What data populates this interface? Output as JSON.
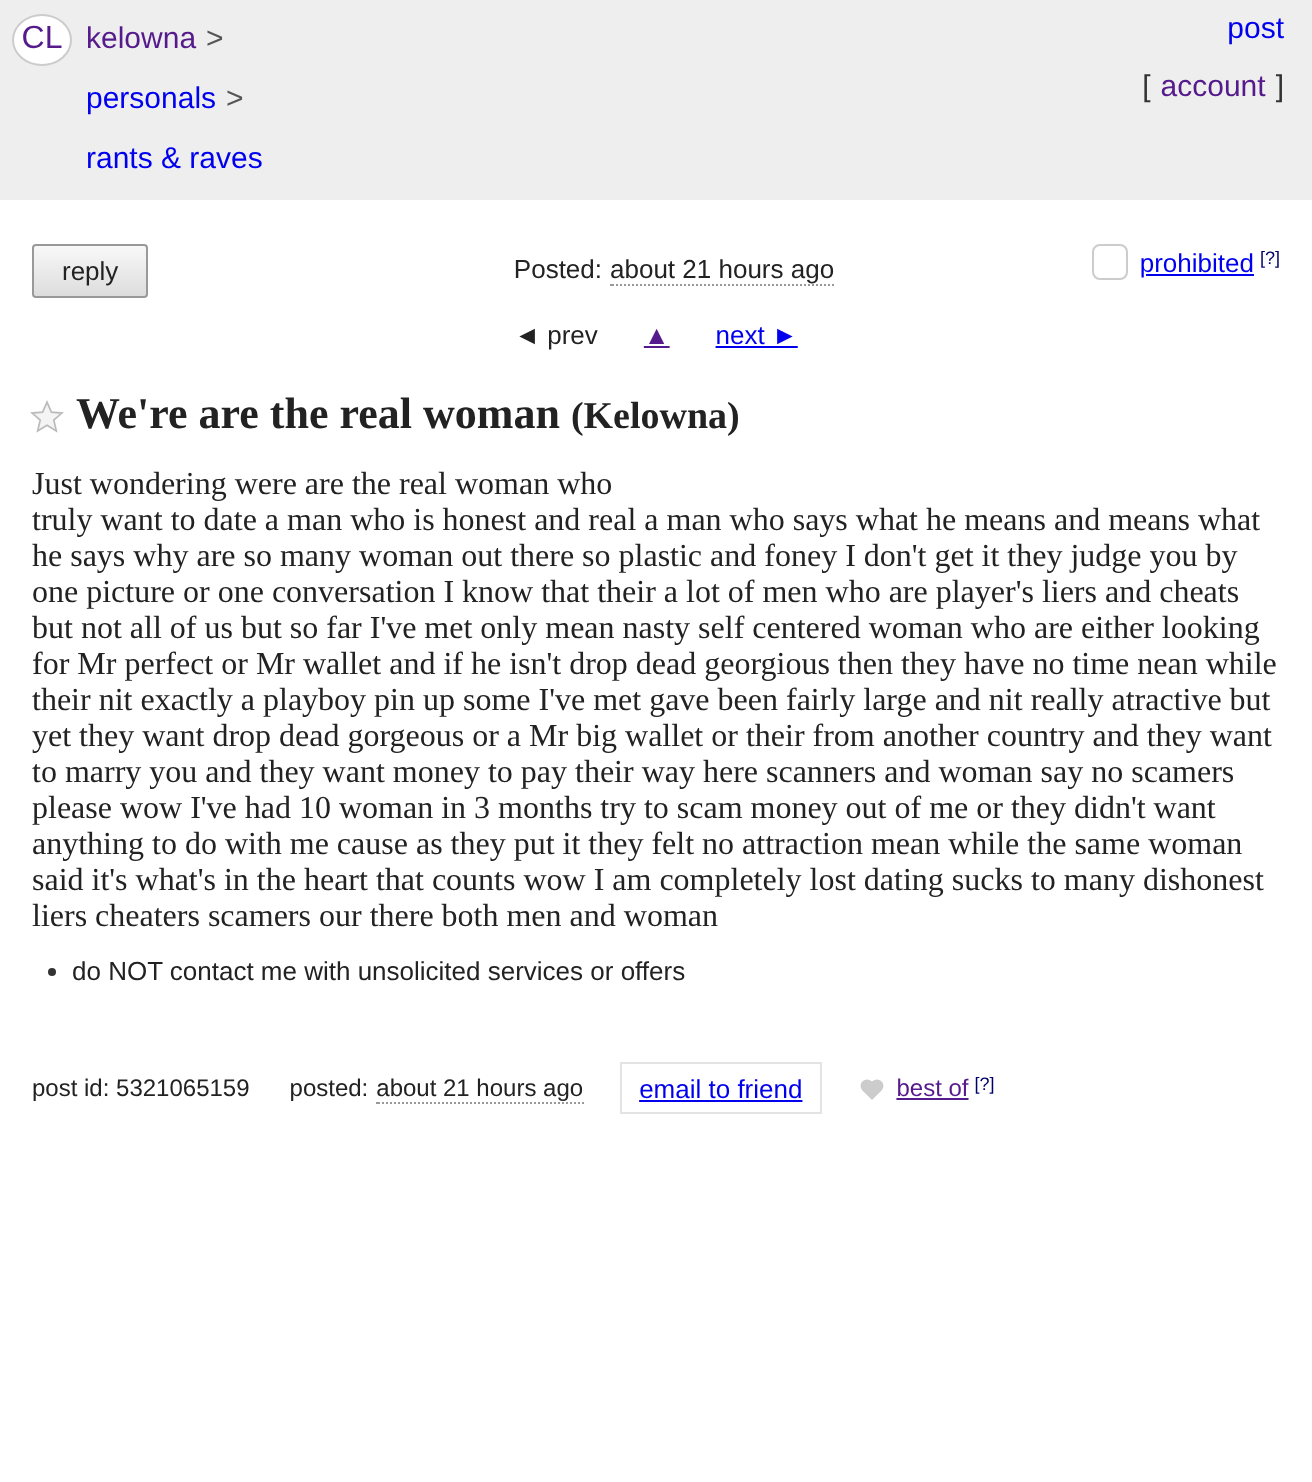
{
  "header": {
    "logo": "CL",
    "breadcrumbs": [
      {
        "label": "kelowna",
        "separator": ">",
        "visited": true
      },
      {
        "label": "personals",
        "separator": ">",
        "visited": false
      },
      {
        "label": "rants & raves",
        "visited": false
      }
    ],
    "post_link": {
      "label": "post",
      "visited": false
    },
    "account": {
      "open": "[",
      "label": "account",
      "close": "]",
      "visited": true
    }
  },
  "toolbar": {
    "reply_button": "reply",
    "posted": {
      "label": "Posted:",
      "time": "about 21 hours ago"
    },
    "flag": {
      "checked": false,
      "label": "prohibited",
      "help": "[?]"
    }
  },
  "nav": [
    {
      "kind": "text",
      "label": "◄ prev"
    },
    {
      "kind": "link",
      "label": "▲",
      "visited": true
    },
    {
      "kind": "link",
      "label": "next ►",
      "visited": false
    }
  ],
  "posting": {
    "favorited": false,
    "title": "We're are the real woman",
    "location": "(Kelowna)",
    "body": [
      "Just wondering were are the real woman who",
      "truly want to date a man who is honest and real a man who says what he means and means what he says why are so many woman out there so plastic and foney I don't get it they judge you by one picture or one conversation I know that their a lot of men who are player's liers and cheats but not all of us but so far I've met only mean nasty self centered woman who are either looking for Mr perfect or Mr wallet and if he isn't drop dead georgious then they have no time nean while their nit exactly a playboy pin up some I've met gave been fairly large and nit really atractive but yet they want drop dead gorgeous or a Mr big wallet or their from another country and they want to marry you and they want money to pay their way here scanners and woman say no scamers please wow I've had 10 woman in 3 months try to scam money out of me or they didn't want anything to do with me cause as they put it they felt no attraction mean while the same woman said it's what's in the heart that counts wow I am completely lost dating sucks to many dishonest liers cheaters scamers our there both men and woman"
    ],
    "notices": [
      "do NOT contact me with unsolicited services or offers"
    ]
  },
  "footer": {
    "post_id": "post id: 5321065159",
    "posted": {
      "label": "posted:",
      "time": "about 21 hours ago"
    },
    "email_button": "email to friend",
    "best_of": {
      "favorited": false,
      "label": "best of",
      "help": "[?]",
      "visited": true
    }
  }
}
